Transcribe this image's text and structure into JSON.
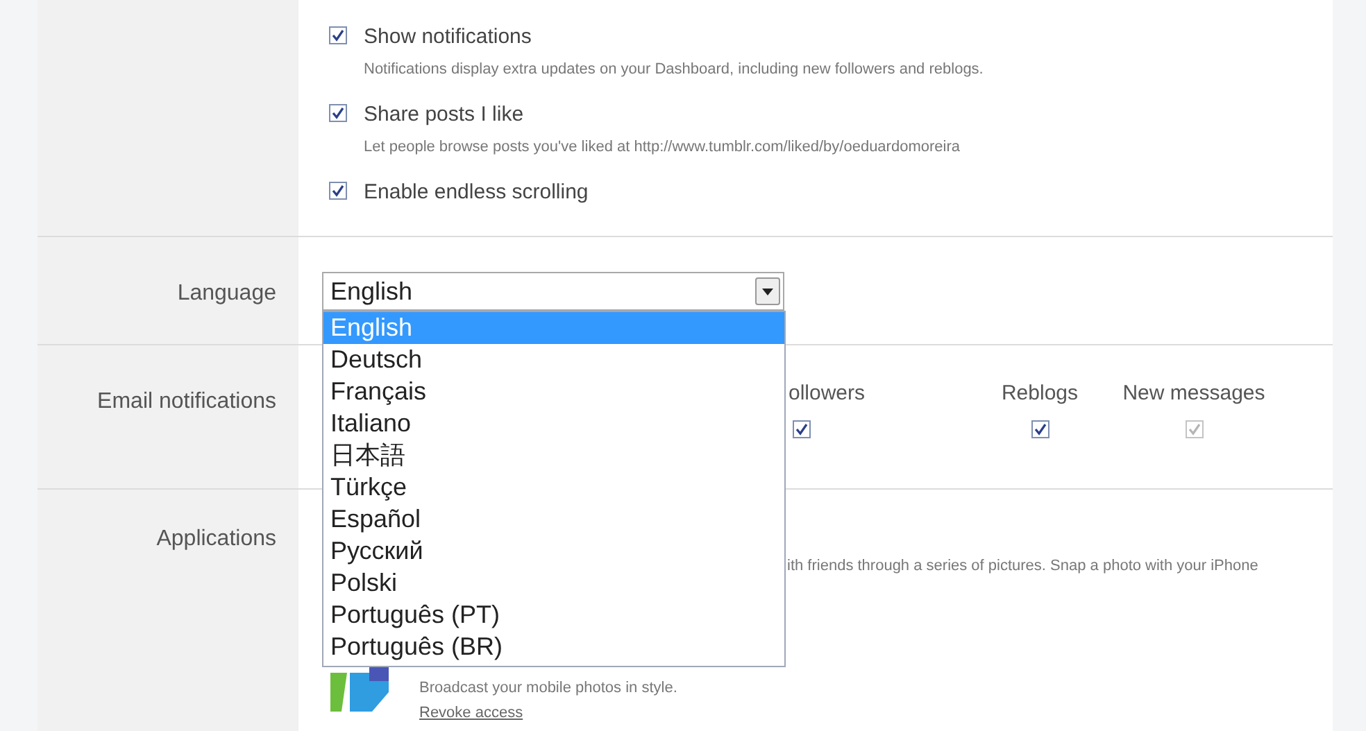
{
  "general_settings": [
    {
      "label": "Show notifications",
      "description": "Notifications display extra updates on your Dashboard, including new followers and reblogs.",
      "checked": true
    },
    {
      "label": "Share posts I like",
      "description": "Let people browse posts you've liked at http://www.tumblr.com/liked/by/oeduardomoreira",
      "checked": true
    },
    {
      "label": "Enable endless scrolling",
      "checked": true
    }
  ],
  "language": {
    "label": "Language",
    "value": "English",
    "expanded": true,
    "options": [
      {
        "label": "English",
        "selected": true
      },
      {
        "label": "Deutsch",
        "selected": false
      },
      {
        "label": "Français",
        "selected": false
      },
      {
        "label": "Italiano",
        "selected": false
      },
      {
        "label": "日本語",
        "selected": false
      },
      {
        "label": "Türkçe",
        "selected": false
      },
      {
        "label": "Español",
        "selected": false
      },
      {
        "label": "Русский",
        "selected": false
      },
      {
        "label": "Polski",
        "selected": false
      },
      {
        "label": "Português (PT)",
        "selected": false
      },
      {
        "label": "Português (BR)",
        "selected": false
      }
    ]
  },
  "email_notifications": {
    "label": "Email notifications",
    "columns": [
      {
        "label": "ollowers",
        "checked": true,
        "disabled": false
      },
      {
        "label": "Reblogs",
        "checked": true,
        "disabled": false
      },
      {
        "label": "New messages",
        "checked": true,
        "disabled": true
      }
    ]
  },
  "applications": {
    "label": "Applications",
    "items": [
      {
        "description": "ith friends through a series of pictures. Snap a photo with your iPhone"
      },
      {
        "description": "Broadcast your mobile photos in style.",
        "action": "Revoke access"
      }
    ]
  }
}
